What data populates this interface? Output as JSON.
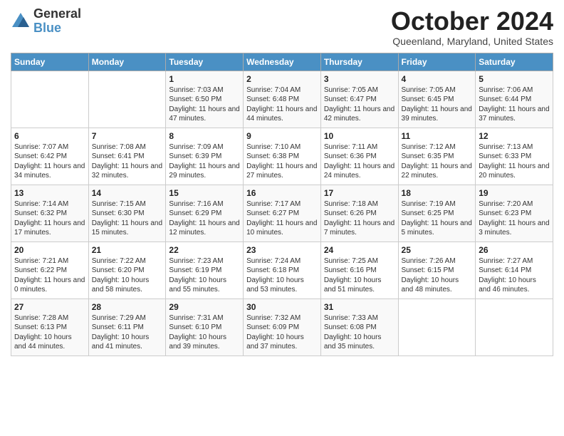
{
  "logo": {
    "general": "General",
    "blue": "Blue"
  },
  "title": "October 2024",
  "location": "Queenland, Maryland, United States",
  "days_of_week": [
    "Sunday",
    "Monday",
    "Tuesday",
    "Wednesday",
    "Thursday",
    "Friday",
    "Saturday"
  ],
  "weeks": [
    [
      {
        "day": "",
        "sunrise": "",
        "sunset": "",
        "daylight": ""
      },
      {
        "day": "",
        "sunrise": "",
        "sunset": "",
        "daylight": ""
      },
      {
        "day": "1",
        "sunrise": "Sunrise: 7:03 AM",
        "sunset": "Sunset: 6:50 PM",
        "daylight": "Daylight: 11 hours and 47 minutes."
      },
      {
        "day": "2",
        "sunrise": "Sunrise: 7:04 AM",
        "sunset": "Sunset: 6:48 PM",
        "daylight": "Daylight: 11 hours and 44 minutes."
      },
      {
        "day": "3",
        "sunrise": "Sunrise: 7:05 AM",
        "sunset": "Sunset: 6:47 PM",
        "daylight": "Daylight: 11 hours and 42 minutes."
      },
      {
        "day": "4",
        "sunrise": "Sunrise: 7:05 AM",
        "sunset": "Sunset: 6:45 PM",
        "daylight": "Daylight: 11 hours and 39 minutes."
      },
      {
        "day": "5",
        "sunrise": "Sunrise: 7:06 AM",
        "sunset": "Sunset: 6:44 PM",
        "daylight": "Daylight: 11 hours and 37 minutes."
      }
    ],
    [
      {
        "day": "6",
        "sunrise": "Sunrise: 7:07 AM",
        "sunset": "Sunset: 6:42 PM",
        "daylight": "Daylight: 11 hours and 34 minutes."
      },
      {
        "day": "7",
        "sunrise": "Sunrise: 7:08 AM",
        "sunset": "Sunset: 6:41 PM",
        "daylight": "Daylight: 11 hours and 32 minutes."
      },
      {
        "day": "8",
        "sunrise": "Sunrise: 7:09 AM",
        "sunset": "Sunset: 6:39 PM",
        "daylight": "Daylight: 11 hours and 29 minutes."
      },
      {
        "day": "9",
        "sunrise": "Sunrise: 7:10 AM",
        "sunset": "Sunset: 6:38 PM",
        "daylight": "Daylight: 11 hours and 27 minutes."
      },
      {
        "day": "10",
        "sunrise": "Sunrise: 7:11 AM",
        "sunset": "Sunset: 6:36 PM",
        "daylight": "Daylight: 11 hours and 24 minutes."
      },
      {
        "day": "11",
        "sunrise": "Sunrise: 7:12 AM",
        "sunset": "Sunset: 6:35 PM",
        "daylight": "Daylight: 11 hours and 22 minutes."
      },
      {
        "day": "12",
        "sunrise": "Sunrise: 7:13 AM",
        "sunset": "Sunset: 6:33 PM",
        "daylight": "Daylight: 11 hours and 20 minutes."
      }
    ],
    [
      {
        "day": "13",
        "sunrise": "Sunrise: 7:14 AM",
        "sunset": "Sunset: 6:32 PM",
        "daylight": "Daylight: 11 hours and 17 minutes."
      },
      {
        "day": "14",
        "sunrise": "Sunrise: 7:15 AM",
        "sunset": "Sunset: 6:30 PM",
        "daylight": "Daylight: 11 hours and 15 minutes."
      },
      {
        "day": "15",
        "sunrise": "Sunrise: 7:16 AM",
        "sunset": "Sunset: 6:29 PM",
        "daylight": "Daylight: 11 hours and 12 minutes."
      },
      {
        "day": "16",
        "sunrise": "Sunrise: 7:17 AM",
        "sunset": "Sunset: 6:27 PM",
        "daylight": "Daylight: 11 hours and 10 minutes."
      },
      {
        "day": "17",
        "sunrise": "Sunrise: 7:18 AM",
        "sunset": "Sunset: 6:26 PM",
        "daylight": "Daylight: 11 hours and 7 minutes."
      },
      {
        "day": "18",
        "sunrise": "Sunrise: 7:19 AM",
        "sunset": "Sunset: 6:25 PM",
        "daylight": "Daylight: 11 hours and 5 minutes."
      },
      {
        "day": "19",
        "sunrise": "Sunrise: 7:20 AM",
        "sunset": "Sunset: 6:23 PM",
        "daylight": "Daylight: 11 hours and 3 minutes."
      }
    ],
    [
      {
        "day": "20",
        "sunrise": "Sunrise: 7:21 AM",
        "sunset": "Sunset: 6:22 PM",
        "daylight": "Daylight: 11 hours and 0 minutes."
      },
      {
        "day": "21",
        "sunrise": "Sunrise: 7:22 AM",
        "sunset": "Sunset: 6:20 PM",
        "daylight": "Daylight: 10 hours and 58 minutes."
      },
      {
        "day": "22",
        "sunrise": "Sunrise: 7:23 AM",
        "sunset": "Sunset: 6:19 PM",
        "daylight": "Daylight: 10 hours and 55 minutes."
      },
      {
        "day": "23",
        "sunrise": "Sunrise: 7:24 AM",
        "sunset": "Sunset: 6:18 PM",
        "daylight": "Daylight: 10 hours and 53 minutes."
      },
      {
        "day": "24",
        "sunrise": "Sunrise: 7:25 AM",
        "sunset": "Sunset: 6:16 PM",
        "daylight": "Daylight: 10 hours and 51 minutes."
      },
      {
        "day": "25",
        "sunrise": "Sunrise: 7:26 AM",
        "sunset": "Sunset: 6:15 PM",
        "daylight": "Daylight: 10 hours and 48 minutes."
      },
      {
        "day": "26",
        "sunrise": "Sunrise: 7:27 AM",
        "sunset": "Sunset: 6:14 PM",
        "daylight": "Daylight: 10 hours and 46 minutes."
      }
    ],
    [
      {
        "day": "27",
        "sunrise": "Sunrise: 7:28 AM",
        "sunset": "Sunset: 6:13 PM",
        "daylight": "Daylight: 10 hours and 44 minutes."
      },
      {
        "day": "28",
        "sunrise": "Sunrise: 7:29 AM",
        "sunset": "Sunset: 6:11 PM",
        "daylight": "Daylight: 10 hours and 41 minutes."
      },
      {
        "day": "29",
        "sunrise": "Sunrise: 7:31 AM",
        "sunset": "Sunset: 6:10 PM",
        "daylight": "Daylight: 10 hours and 39 minutes."
      },
      {
        "day": "30",
        "sunrise": "Sunrise: 7:32 AM",
        "sunset": "Sunset: 6:09 PM",
        "daylight": "Daylight: 10 hours and 37 minutes."
      },
      {
        "day": "31",
        "sunrise": "Sunrise: 7:33 AM",
        "sunset": "Sunset: 6:08 PM",
        "daylight": "Daylight: 10 hours and 35 minutes."
      },
      {
        "day": "",
        "sunrise": "",
        "sunset": "",
        "daylight": ""
      },
      {
        "day": "",
        "sunrise": "",
        "sunset": "",
        "daylight": ""
      }
    ]
  ]
}
